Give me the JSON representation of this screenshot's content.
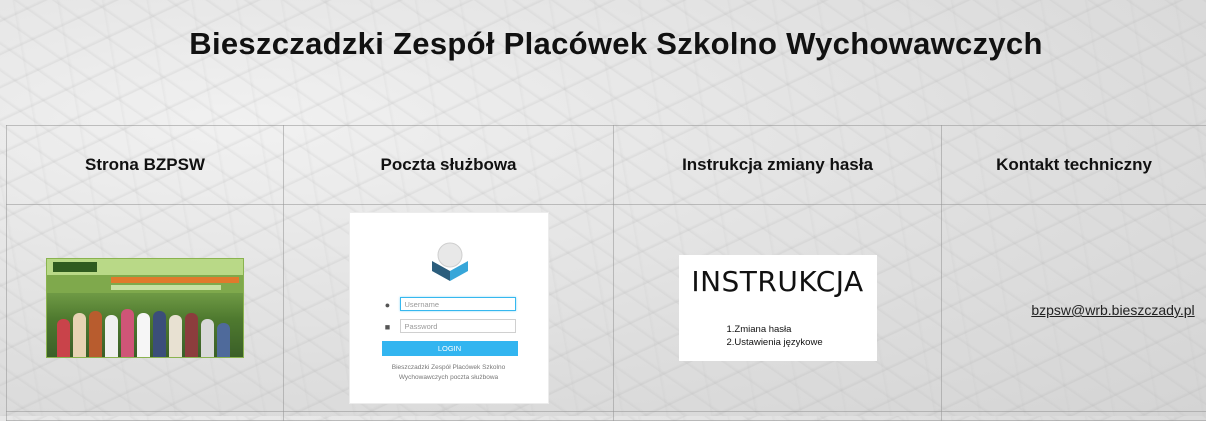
{
  "header": {
    "title": "Bieszczadzki Zespół Placówek Szkolno Wychowawczych"
  },
  "columns": [
    {
      "label": "Strona BZPSW"
    },
    {
      "label": "Poczta służbowa"
    },
    {
      "label": "Instrukcja zmiany hasła"
    },
    {
      "label": "Kontakt techniczny"
    }
  ],
  "mail_thumb": {
    "username_placeholder": "Username",
    "password_placeholder": "Password",
    "login_label": "LOGIN",
    "footer_text": "Bieszczadzki Zespół Placówek Szkolno Wychowawczych poczta służbowa",
    "accent_color": "#32b5f0"
  },
  "instr_thumb": {
    "title": "INSTRUKCJA",
    "items": [
      "1.Zmiana hasła",
      "2.Ustawienia językowe"
    ]
  },
  "contact": {
    "email": "bzpsw@wrb.bieszczady.pl"
  }
}
